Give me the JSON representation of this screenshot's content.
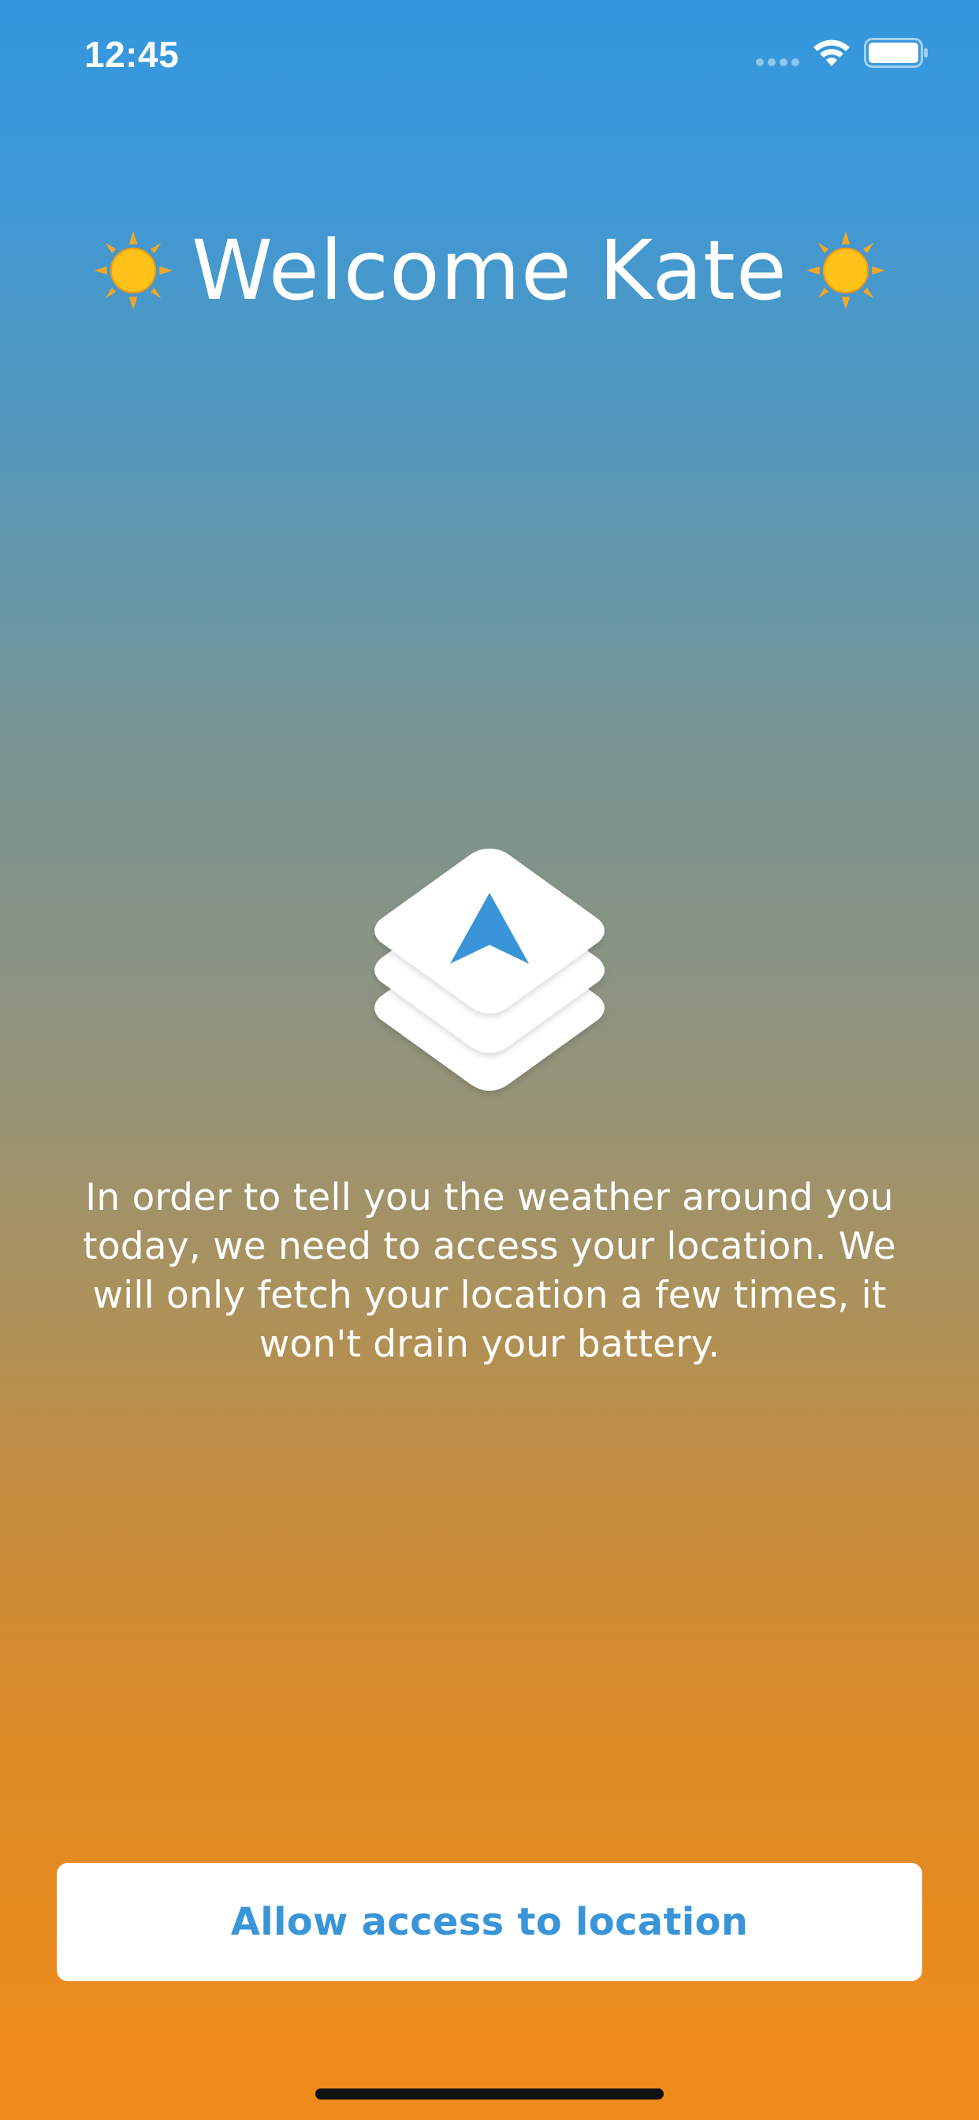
{
  "status_bar": {
    "time": "12:45",
    "signal_icon": "cellular-signal-icon",
    "wifi_icon": "wifi-icon",
    "battery_icon": "battery-icon"
  },
  "header": {
    "title": "Welcome Kate",
    "left_icon": "sun-emoji-icon",
    "right_icon": "sun-emoji-icon"
  },
  "main": {
    "icon": "location-arrow-stack-icon",
    "description": "In order to tell you the weather around you today, we need to access your location. We will only fetch your location a few times, it won't drain your battery."
  },
  "actions": {
    "allow_label": "Allow access to location"
  },
  "colors": {
    "gradient_top": "#3497de",
    "gradient_bottom": "#f08b19",
    "accent": "#3a95d8",
    "button_bg": "#ffffff"
  }
}
